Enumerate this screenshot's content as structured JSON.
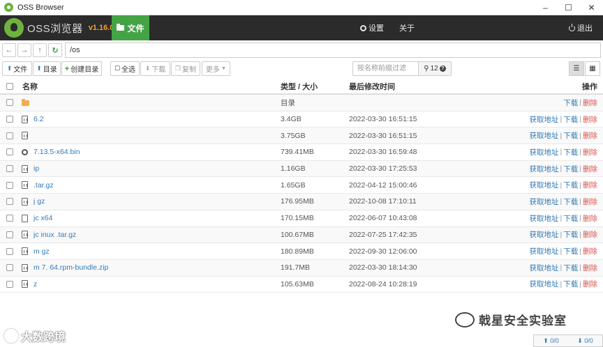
{
  "window": {
    "title": "OSS Browser",
    "minimize": "–",
    "maximize": "☐",
    "close": "✕"
  },
  "header": {
    "app_name": "OSS浏览器",
    "version": "v1.16.0",
    "files_tab": "文件",
    "settings": "设置",
    "about": "关于",
    "logout": "退出"
  },
  "address": {
    "path": "/os"
  },
  "toolbar": {
    "upload_file": "文件",
    "upload_dir": "目录",
    "create_dir": "创建目录",
    "select_all": "全选",
    "download": "下载",
    "copy": "复制",
    "more": "更多",
    "search_placeholder": "按名称前缀过滤",
    "count": "12"
  },
  "table": {
    "headers": {
      "name": "名称",
      "type_size": "类型 / 大小",
      "modified": "最后修改时间",
      "ops": "操作"
    },
    "op_labels": {
      "get_url": "获取地址",
      "download": "下载",
      "delete": "删除",
      "sep": "|"
    },
    "rows": [
      {
        "icon": "folder",
        "name": "",
        "size": "目录",
        "time": "",
        "has_url": false
      },
      {
        "icon": "file",
        "name": "          6.2",
        "size": "3.4GB",
        "time": "2022-03-30 16:51:15",
        "has_url": true
      },
      {
        "icon": "file",
        "name": "",
        "size": "3.75GB",
        "time": "2022-03-30 16:51:15",
        "has_url": true
      },
      {
        "icon": "gear",
        "name": "                    7.13.5-x64.bin",
        "size": "739.41MB",
        "time": "2022-03-30 16:59:48",
        "has_url": true
      },
      {
        "icon": "file",
        "name": "                  ip",
        "size": "1.16GB",
        "time": "2022-03-30 17:25:53",
        "has_url": true
      },
      {
        "icon": "file",
        "name": "                  .tar.gz",
        "size": "1.65GB",
        "time": "2022-04-12 15:00:46",
        "has_url": true
      },
      {
        "icon": "file",
        "name": "j                    gz",
        "size": "176.95MB",
        "time": "2022-10-08 17:10:11",
        "has_url": true
      },
      {
        "icon": "plain",
        "name": "jc              x64",
        "size": "170.15MB",
        "time": "2022-06-07 10:43:08",
        "has_url": true
      },
      {
        "icon": "file",
        "name": "jc         inux    .tar.gz",
        "size": "100.67MB",
        "time": "2022-07-25 17:42:35",
        "has_url": true
      },
      {
        "icon": "file",
        "name": "m              gz",
        "size": "180.89MB",
        "time": "2022-09-30 12:06:00",
        "has_url": true
      },
      {
        "icon": "file",
        "name": "m        7.      64.rpm-bundle.zip",
        "size": "191.7MB",
        "time": "2022-03-30 18:14:30",
        "has_url": true
      },
      {
        "icon": "file",
        "name": "               z",
        "size": "105.63MB",
        "time": "2022-08-24 10:28:19",
        "has_url": true
      }
    ]
  },
  "watermarks": {
    "left": "大数跨境",
    "right": "戟星安全实验室"
  },
  "status": {
    "up": "0/0",
    "down": "0/0"
  }
}
